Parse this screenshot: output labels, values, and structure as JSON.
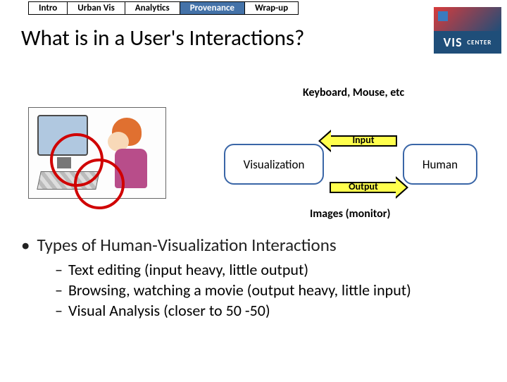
{
  "tabs": {
    "items": [
      "Intro",
      "Urban Vis",
      "Analytics",
      "Provenance",
      "Wrap-up"
    ],
    "active_index": 3
  },
  "title": "What is in a User's Interactions?",
  "logo": {
    "text": "VIS",
    "sub": "CENTER"
  },
  "diagram": {
    "top_label": "Keyboard, Mouse, etc",
    "box_vis": "Visualization",
    "box_human": "Human",
    "arrow_input": "Input",
    "arrow_output": "Output",
    "bottom_label": "Images (monitor)"
  },
  "bullets": {
    "main": "Types of Human-Visualization Interactions",
    "subs": [
      "Text editing (input heavy, little output)",
      "Browsing, watching a movie (output heavy, little input)",
      "Visual Analysis (closer to 50 -50)"
    ]
  }
}
